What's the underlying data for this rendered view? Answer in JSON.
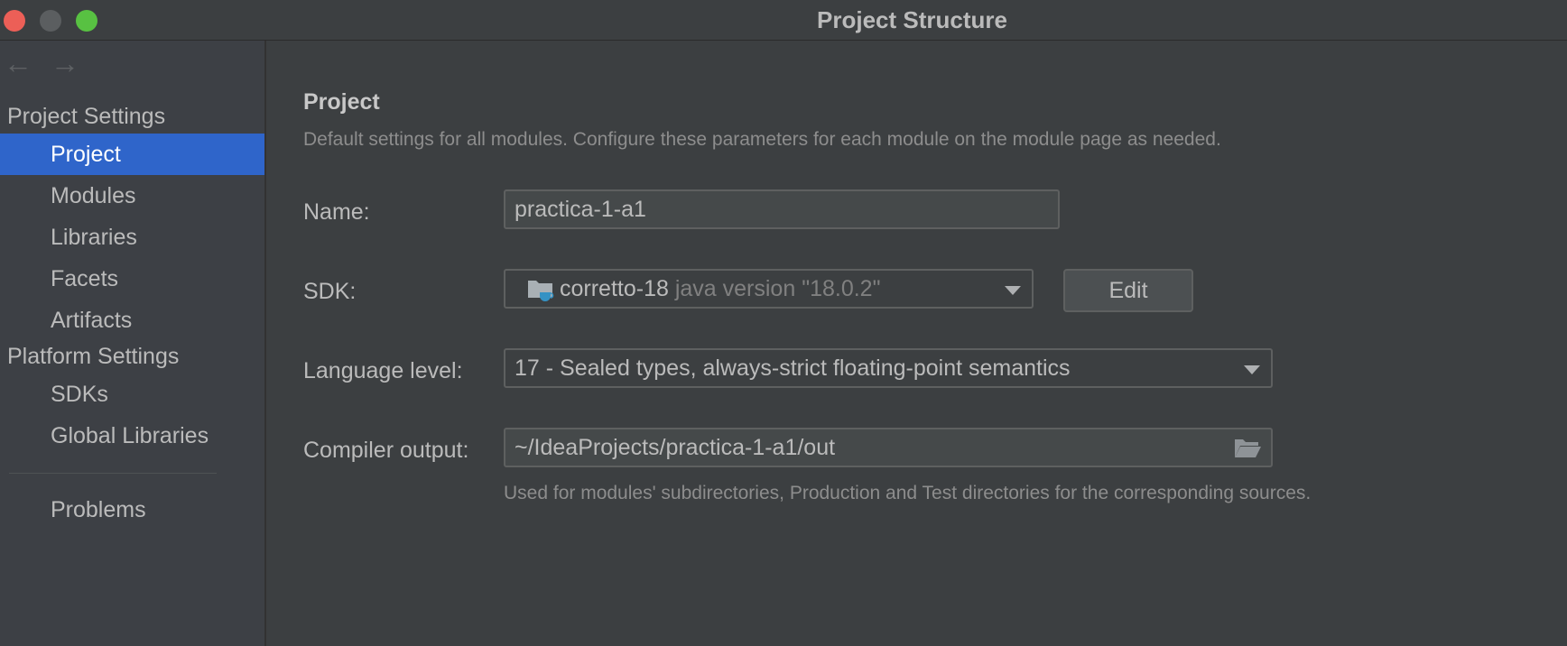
{
  "window": {
    "title": "Project Structure"
  },
  "sidebar": {
    "project_settings_header": "Project Settings",
    "project_items": [
      {
        "label": "Project"
      },
      {
        "label": "Modules"
      },
      {
        "label": "Libraries"
      },
      {
        "label": "Facets"
      },
      {
        "label": "Artifacts"
      }
    ],
    "platform_settings_header": "Platform Settings",
    "platform_items": [
      {
        "label": "SDKs"
      },
      {
        "label": "Global Libraries"
      }
    ],
    "problems_label": "Problems"
  },
  "main": {
    "title": "Project",
    "description": "Default settings for all modules. Configure these parameters for each module on the module page as needed.",
    "name": {
      "label": "Name:",
      "value": "practica-1-a1"
    },
    "sdk": {
      "label": "SDK:",
      "name": "corretto-18",
      "version": "java version \"18.0.2\"",
      "edit_label": "Edit"
    },
    "language_level": {
      "label": "Language level:",
      "value": "17 - Sealed types, always-strict floating-point semantics"
    },
    "compiler_output": {
      "label": "Compiler output:",
      "value": "~/IdeaProjects/practica-1-a1/out",
      "help": "Used for modules' subdirectories, Production and Test directories for the corresponding sources."
    }
  },
  "colors": {
    "selection": "#2f65ca",
    "background": "#3c3f41",
    "sidebar": "#3d4045"
  }
}
